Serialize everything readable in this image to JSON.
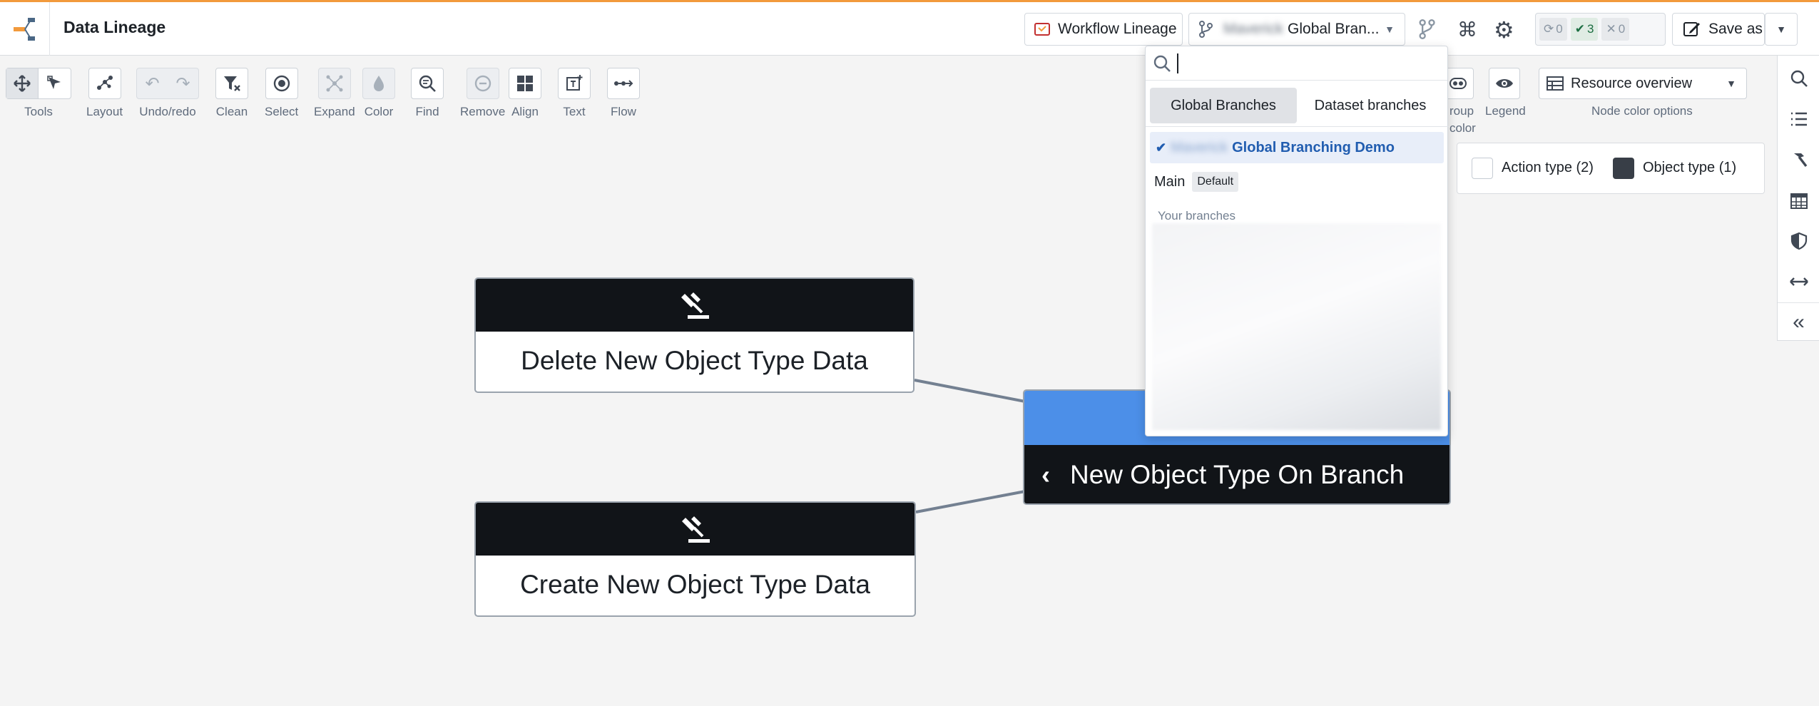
{
  "app": {
    "title": "Data Lineage"
  },
  "header": {
    "workflow_lineage": "Workflow Lineage",
    "branch_prefix": "Maverick",
    "branch_name": "Global Bran...",
    "status_sync": "0",
    "status_ok": "3",
    "status_err": "0",
    "save_as": "Save as"
  },
  "toolbar": {
    "tools": "Tools",
    "layout": "Layout",
    "undo_redo": "Undo/redo",
    "clean": "Clean",
    "select": "Select",
    "expand": "Expand",
    "color": "Color",
    "find": "Find",
    "remove": "Remove",
    "align": "Align",
    "text": "Text",
    "flow": "Flow",
    "group_color_a": "roup",
    "group_color_b": "color",
    "legend": "Legend",
    "node_color_value": "Resource overview",
    "node_color_label": "Node color options"
  },
  "legend": {
    "action_type": "Action type (2)",
    "object_type": "Object type (1)"
  },
  "nodes": {
    "delete": "Delete New Object Type Data",
    "create": "Create New Object Type Data",
    "object": "New Object Type On Branch"
  },
  "dropdown": {
    "tab_global": "Global Branches",
    "tab_dataset": "Dataset branches",
    "selected_prefix": "Maverick",
    "selected_name": "Global Branching Demo",
    "main": "Main",
    "default_tag": "Default",
    "your_branches": "Your branches"
  },
  "colors": {
    "accent_orange": "#f29a3c",
    "object_blue": "#4c8fe8",
    "node_dark": "#111418",
    "selected_text": "#215db0",
    "ok_green": "#1c6e42"
  }
}
